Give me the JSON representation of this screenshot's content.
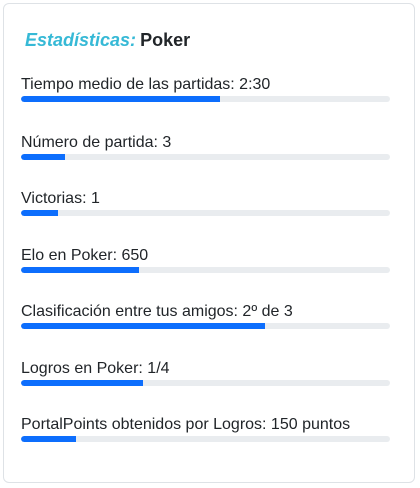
{
  "card": {
    "label": "Estadísticas:",
    "game": "Poker"
  },
  "stats": [
    {
      "text": "Tiempo medio de las partidas: 2:30",
      "progress": 0.54
    },
    {
      "text": "Número de partida: 3",
      "progress": 0.12
    },
    {
      "text": "Victorias: 1",
      "progress": 0.1
    },
    {
      "text": "Elo en Poker: 650",
      "progress": 0.32
    },
    {
      "text": "Clasificación entre tus amigos: 2º de 3",
      "progress": 0.66
    },
    {
      "text": "Logros en Poker: 1/4",
      "progress": 0.33
    },
    {
      "text": "PortalPoints obtenidos por Logros: 150 puntos",
      "progress": 0.15
    }
  ],
  "colors": {
    "accent": "#36b9d6",
    "bar_fill": "#0d6efd",
    "bar_track": "#e9ecef"
  }
}
